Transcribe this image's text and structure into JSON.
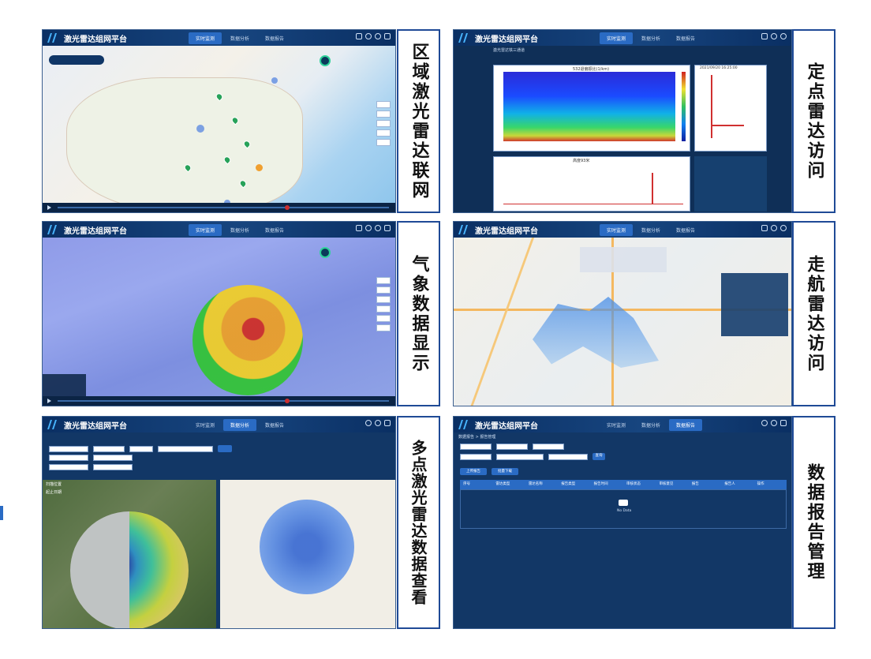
{
  "app": {
    "title": "激光雷达组网平台"
  },
  "tabs": [
    "实时监测",
    "数据分析",
    "数据报告"
  ],
  "captions": {
    "panel1": "区域激光雷达联网",
    "panel2": "定点雷达访问",
    "panel3": "气象数据显示",
    "panel4": "走航雷达访问",
    "panel5": "多点激光雷达数据查看",
    "panel6": "数据报告管理"
  },
  "panel2": {
    "window_title": "激光雷达铁三通道",
    "heat_title": "532退偏振比(1/km)",
    "line_title": "高度93米",
    "time": "2021/09/20 16:25:00"
  },
  "panel5": {
    "label_time": "扫描位置",
    "label_date": "起止日期"
  },
  "panel6": {
    "breadcrumb": "数据报告 > 报告管理",
    "upload_label": "上传报告",
    "download_label": "批量下载",
    "query_label": "查询",
    "table_headers": [
      "序号",
      "雷达类型",
      "雷达名称",
      "报告类型",
      "报告时间",
      "审核状态",
      "审核意见",
      "报告",
      "报告人",
      "操作"
    ],
    "no_data": "No Data"
  },
  "colors": {
    "header": "#0a2f63",
    "accent": "#2a6bc4",
    "caption_border": "#1f4a96"
  }
}
